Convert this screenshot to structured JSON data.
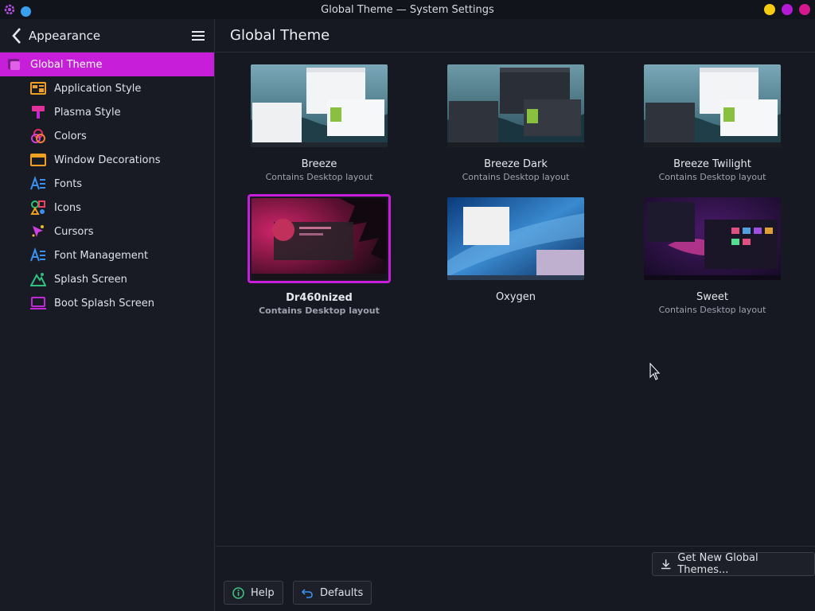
{
  "window": {
    "title": "Global Theme — System Settings"
  },
  "sidebar": {
    "header_label": "Appearance",
    "items": [
      {
        "label": "Global Theme",
        "icon": "global-theme-icon",
        "active": true
      },
      {
        "label": "Application Style",
        "icon": "application-style-icon"
      },
      {
        "label": "Plasma Style",
        "icon": "plasma-style-icon"
      },
      {
        "label": "Colors",
        "icon": "colors-icon"
      },
      {
        "label": "Window Decorations",
        "icon": "window-decorations-icon"
      },
      {
        "label": "Fonts",
        "icon": "fonts-icon"
      },
      {
        "label": "Icons",
        "icon": "icons-icon"
      },
      {
        "label": "Cursors",
        "icon": "cursors-icon"
      },
      {
        "label": "Font Management",
        "icon": "font-management-icon"
      },
      {
        "label": "Splash Screen",
        "icon": "splash-screen-icon"
      },
      {
        "label": "Boot Splash Screen",
        "icon": "boot-splash-icon"
      }
    ]
  },
  "main": {
    "title": "Global Theme",
    "themes": [
      {
        "name": "Breeze",
        "subtitle": "Contains Desktop layout"
      },
      {
        "name": "Breeze Dark",
        "subtitle": "Contains Desktop layout"
      },
      {
        "name": "Breeze Twilight",
        "subtitle": "Contains Desktop layout"
      },
      {
        "name": "Dr460nized",
        "subtitle": "Contains Desktop layout",
        "selected": true
      },
      {
        "name": "Oxygen",
        "subtitle": ""
      },
      {
        "name": "Sweet",
        "subtitle": "Contains Desktop layout"
      }
    ],
    "get_new_label": "Get New Global Themes...",
    "help_label": "Help",
    "defaults_label": "Defaults"
  },
  "colors": {
    "accent": "#c71fd9",
    "background": "#161822",
    "sidebar": "#181a24"
  }
}
